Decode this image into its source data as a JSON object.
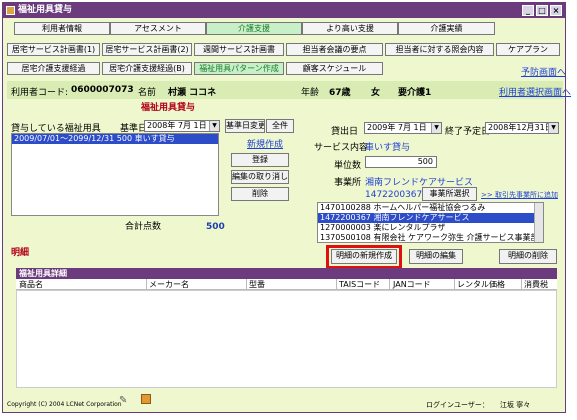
{
  "window": {
    "title": "福祉用具貸与"
  },
  "nav_row1": [
    "利用者情報",
    "アセスメント",
    "介護支援",
    "より高い支援",
    "介護実績"
  ],
  "nav_row2": [
    "居宅サービス計画書(1)",
    "居宅サービス計画書(2)",
    "週間サービス計画書",
    "担当者会議の要点",
    "担当者に対する照会内容",
    "ケアプラン"
  ],
  "nav_row3": [
    "居宅介護支援経過",
    "居宅介護支援経過(B)",
    "福祉用具パターン作成",
    "顧客スケジュール"
  ],
  "links": {
    "forecast": "予防画面へ",
    "user_select": "利用者選択画面へ",
    "new_create": "新規作成",
    "to_office": ">> 取引先事業所に追加"
  },
  "info": {
    "user_code_label": "利用者コード:",
    "user_code": "0600007073",
    "name_label": "名前",
    "name": "村瀬 ココネ",
    "age_label": "年齢",
    "age": "67歳",
    "gender": "女",
    "care_level": "要介護1"
  },
  "section_title": "福祉用具貸与",
  "left": {
    "rental_label": "貸与している福祉用具",
    "base_date_label": "基準日",
    "base_date": "2008年 7月 1日",
    "btn_base_change": "基準日変更",
    "btn_all": "全件",
    "items": [
      "2009/07/01～2099/12/31     500    車いす貸与"
    ],
    "btn_register": "登録",
    "btn_cancel_edit": "編集の取り消し",
    "btn_delete": "削除",
    "total_label": "合計点数",
    "total_value": "500"
  },
  "right": {
    "rent_date_label": "貸出日",
    "rent_date": "2009年 7月 1日",
    "end_date_label": "終了予定日",
    "end_date": "2008年12月31日",
    "service_label": "サービス内容",
    "service_value": "車いす貸与",
    "units_label": "単位数",
    "units_value": "500",
    "office_label": "事業所",
    "office_name": "湘南フレンドケアサービス",
    "office_code": "1472200367",
    "btn_office_select": "事業所選択",
    "office_list": [
      "1470100288 ホームヘルパー福祉協会つるみ",
      "1472200367 湘南フレンドケアサービス",
      "1270000003 楽にレンタルプラザ",
      "1370500108 有限会社 ケアワーク弥生 介護サービス事業部"
    ]
  },
  "detail": {
    "label": "明細",
    "btn_new": "明細の新規作成",
    "btn_edit": "明細の編集",
    "btn_delete": "明細の削除",
    "grid_title": "福祉用具詳細",
    "columns": [
      "商品名",
      "メーカー名",
      "型番",
      "TAISコード",
      "JANコード",
      "レンタル価格",
      "消費税"
    ]
  },
  "footer": {
    "copyright": "Copyright (C) 2004 LCNet Corporation",
    "login_label": "ログインユーザー：",
    "login_user": "江坂 寧々"
  }
}
